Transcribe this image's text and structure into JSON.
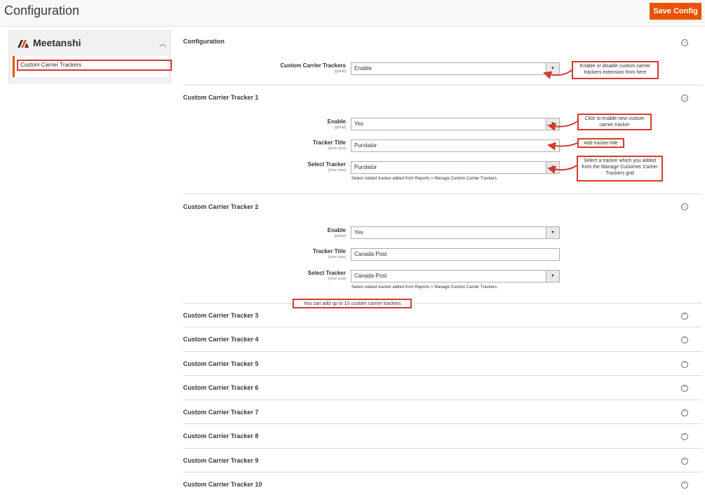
{
  "header": {
    "title": "Configuration",
    "save_label": "Save Config"
  },
  "sidebar": {
    "brand": "Meetanshi",
    "item": "Custom Carrier Trackers"
  },
  "sections": {
    "configuration": {
      "title": "Configuration",
      "field_label": "Custom Carrier Trackers",
      "field_scope": "[global]",
      "field_value": "Enable"
    },
    "tracker1": {
      "title": "Custom Carrier Tracker 1",
      "enable_label": "Enable",
      "enable_scope": "[global]",
      "enable_value": "Yes",
      "title_label": "Tracker Title",
      "title_scope": "[store view]",
      "title_value": "Purolator",
      "select_label": "Select Tracker",
      "select_scope": "[store view]",
      "select_value": "Purolator",
      "note": "Select related tracker added from Reports > Manage Custom Carrier Trackers."
    },
    "tracker2": {
      "title": "Custom Carrier Tracker 2",
      "enable_label": "Enable",
      "enable_scope": "[global]",
      "enable_value": "Yes",
      "title_label": "Tracker Title",
      "title_scope": "[store view]",
      "title_value": "Canada Post",
      "select_label": "Select Tracker",
      "select_scope": "[store view]",
      "select_value": "Canada Post",
      "note": "Select related tracker added from Reports > Manage Custom Carrier Trackers."
    },
    "collapsed": [
      "Custom Carrier Tracker 3",
      "Custom Carrier Tracker 4",
      "Custom Carrier Tracker 5",
      "Custom Carrier Tracker 6",
      "Custom Carrier Tracker 7",
      "Custom Carrier Tracker 8",
      "Custom Carrier Tracker 9",
      "Custom Carrier Tracker 10"
    ]
  },
  "callouts": {
    "enable_ext": "Enable or disable custom carrier trackers extension from here",
    "enable_new": "Click to enable new custom carrier tracker",
    "add_title": "Add tracker title",
    "select_tracker": "Select a tracker which you added from the Manage Customer Carrier Trackers grid",
    "up_to_10": "You can add up to 10 custom carrier trackers"
  },
  "colors": {
    "accent": "#eb5202",
    "callout_border": "#d23b2e"
  },
  "icons": {
    "expanded": "chevron-up-icon",
    "collapsed": "chevron-down-icon",
    "select": "caret-down-icon"
  }
}
